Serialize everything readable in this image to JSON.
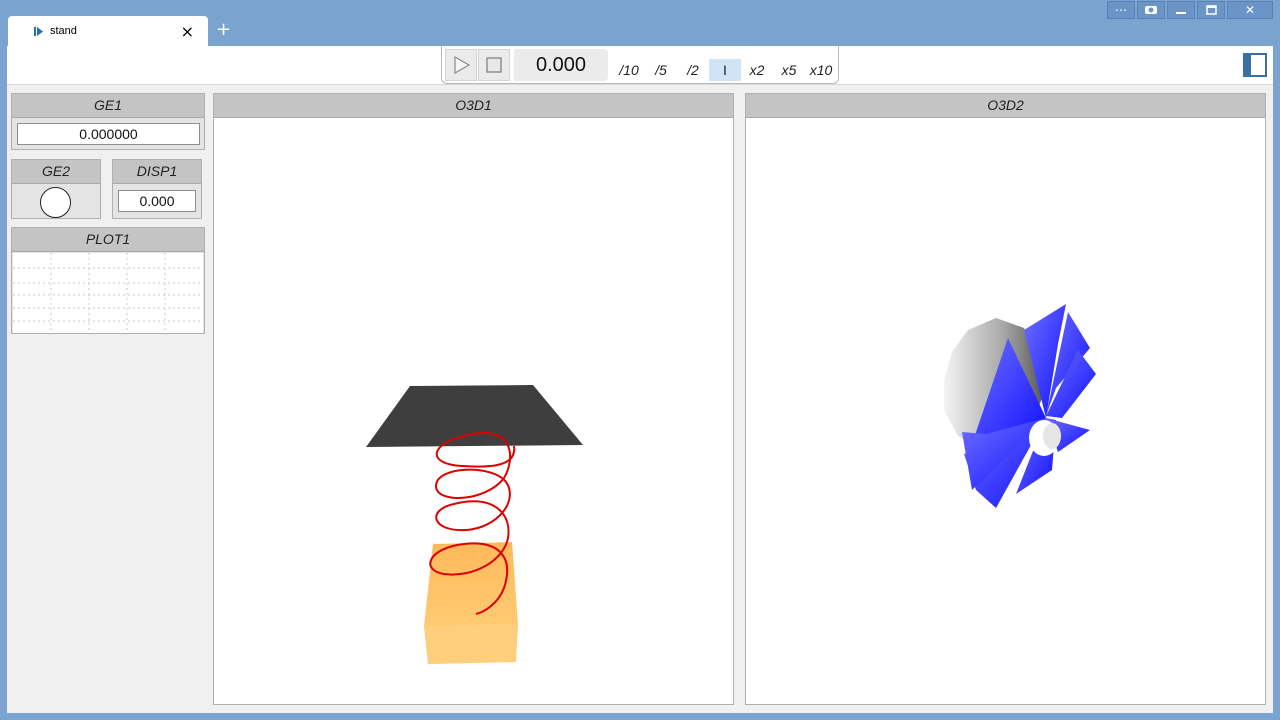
{
  "window": {
    "controls": [
      "more",
      "screenshot",
      "minimize",
      "maximize",
      "close"
    ]
  },
  "tabs": [
    {
      "label": "stand",
      "icon": "play-sim-icon"
    }
  ],
  "toolbar": {
    "time": "0.000",
    "speeds": [
      "/10",
      "/5",
      "/2",
      "I",
      "x2",
      "x5",
      "x10"
    ],
    "active_speed": "I"
  },
  "panels": {
    "ge1": {
      "title": "GE1",
      "value": "0.000000"
    },
    "ge2": {
      "title": "GE2"
    },
    "disp1": {
      "title": "DISP1",
      "value": "0.000"
    },
    "plot1": {
      "title": "PLOT1"
    }
  },
  "views": {
    "o3d1": {
      "title": "O3D1"
    },
    "o3d2": {
      "title": "O3D2"
    }
  },
  "colors": {
    "frame": "#7aa3d0",
    "spring": "#dd0000",
    "mass": "#ffc070",
    "top_plate": "#3e3e3e",
    "blades": "#4040ff"
  }
}
